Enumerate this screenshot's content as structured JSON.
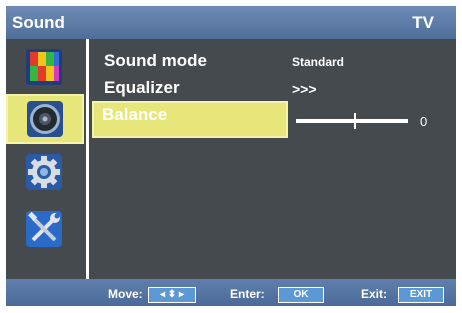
{
  "header": {
    "title": "Sound",
    "source": "TV"
  },
  "sidebar": {
    "items": [
      {
        "icon": "picture-icon",
        "selected": false
      },
      {
        "icon": "speaker-icon",
        "selected": true
      },
      {
        "icon": "gear-icon",
        "selected": false
      },
      {
        "icon": "tools-icon",
        "selected": false
      }
    ]
  },
  "menu": {
    "rows": [
      {
        "label": "Sound mode",
        "value": "Standard"
      },
      {
        "label": "Equalizer",
        "value": ">>>"
      },
      {
        "label": "Balance",
        "value": "0"
      }
    ]
  },
  "footer": {
    "move_label": "Move:",
    "move_key": "◂ ⬍ ▸",
    "enter_label": "Enter:",
    "enter_key": "OK",
    "exit_label": "Exit:",
    "exit_key": "EXIT"
  },
  "colors": {
    "panel": "#454a4f",
    "header": "#5b7aa6",
    "highlight": "#e6e67a",
    "key": "#5b98d4"
  }
}
